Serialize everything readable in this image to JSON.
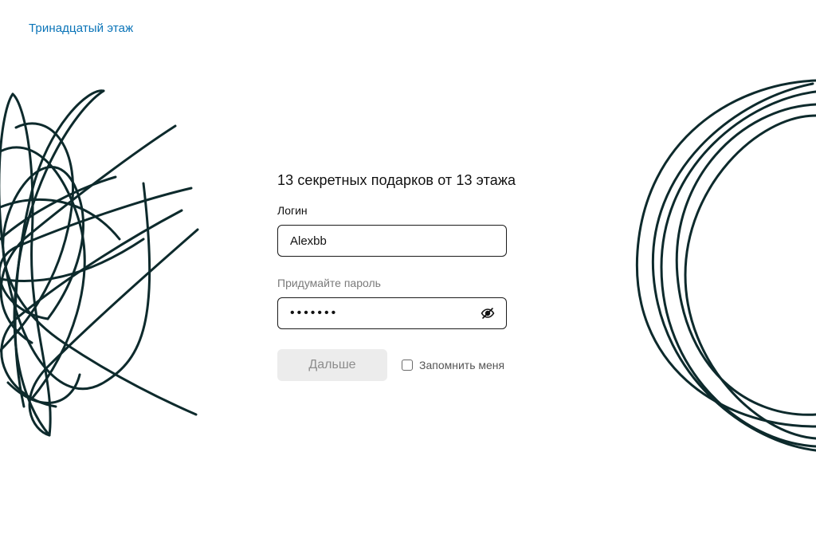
{
  "header": {
    "brand_link": "Тринадцатый этаж"
  },
  "form": {
    "title": "13 секретных подарков от 13 этажа",
    "login": {
      "label": "Логин",
      "value": "Alexbb"
    },
    "password": {
      "label": "Придумайте пароль",
      "value": "•••••••"
    },
    "next_button": "Дальше",
    "remember_me": {
      "label": "Запомнить меня",
      "checked": false
    }
  },
  "colors": {
    "brand_link": "#0a74b8",
    "scribble": "#0d2a2c",
    "button_bg_disabled": "#ececec"
  },
  "icons": {
    "password_toggle": "eye-crossed-icon"
  }
}
